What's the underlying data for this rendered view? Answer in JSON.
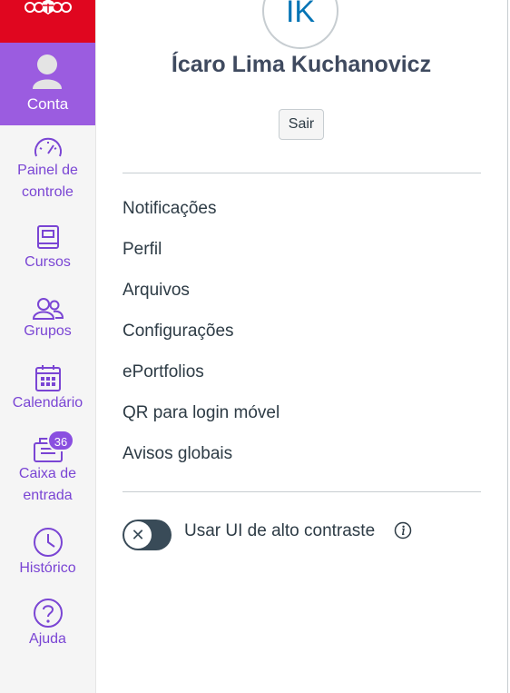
{
  "global_nav": {
    "account_label": "Conta",
    "items": [
      {
        "label_line1": "Painel de",
        "label_line2": "controle",
        "icon": "dashboard-icon"
      },
      {
        "label_line1": "Cursos",
        "icon": "courses-icon"
      },
      {
        "label_line1": "Grupos",
        "icon": "groups-icon"
      },
      {
        "label_line1": "Calendário",
        "icon": "calendar-icon"
      },
      {
        "label_line1": "Caixa de",
        "label_line2": "entrada",
        "icon": "inbox-icon",
        "badge": "36"
      },
      {
        "label_line1": "Histórico",
        "icon": "history-icon"
      },
      {
        "label_line1": "Ajuda",
        "icon": "help-icon"
      }
    ]
  },
  "tray": {
    "avatar_initials": "IK",
    "user_name": "Ícaro Lima Kuchanovicz",
    "logout_label": "Sair",
    "links": [
      "Notificações",
      "Perfil",
      "Arquivos",
      "Configurações",
      "ePortfolios",
      "QR para login móvel",
      "Avisos globais"
    ],
    "high_contrast_label": "Usar UI de alto contraste",
    "high_contrast_on": false
  },
  "colors": {
    "brand_red": "#e0061f",
    "accent_purple": "#9b5ce0",
    "nav_text": "#7a45d4",
    "text_dark": "#2d3b45"
  }
}
